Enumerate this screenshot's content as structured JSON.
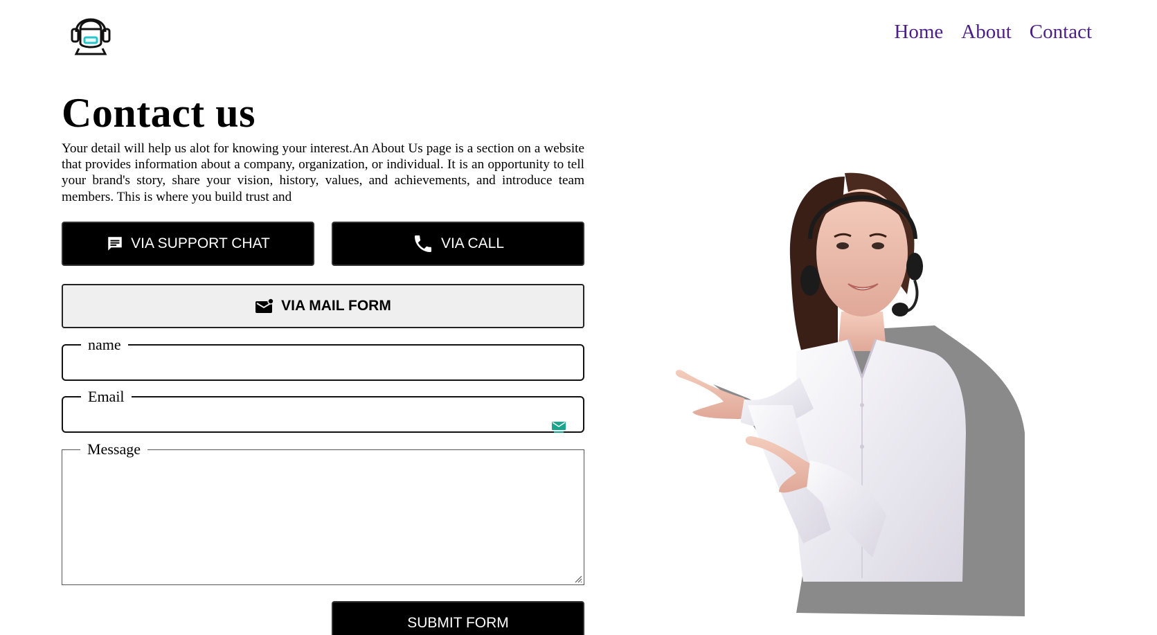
{
  "header": {
    "logo_icon": "support-agent-headset-icon",
    "nav": [
      {
        "label": "Home"
      },
      {
        "label": "About"
      },
      {
        "label": "Contact"
      }
    ],
    "nav_color": "#4b1f86"
  },
  "main": {
    "title": "Contact us",
    "intro": "Your detail will help us alot for knowing your interest.An About Us page is a section on a website that provides information about a company, organization, or individual. It is an opportunity to tell your brand's story, share your vision, history, values, and achievements, and introduce team members. This is where you build trust and",
    "buttons": {
      "chat": {
        "label": "VIA SUPPORT CHAT",
        "icon": "chat-icon"
      },
      "call": {
        "label": "VIA CALL",
        "icon": "phone-icon"
      },
      "mail": {
        "label": "VIA MAIL FORM",
        "icon": "mail-icon"
      }
    },
    "form": {
      "name_legend": "name",
      "name_value": "",
      "email_legend": "Email",
      "email_value": "",
      "message_legend": "Message",
      "message_value": "",
      "submit_label": "SUBMIT FORM"
    }
  },
  "hero": {
    "image": "support-agent-woman-with-headset-photo"
  }
}
